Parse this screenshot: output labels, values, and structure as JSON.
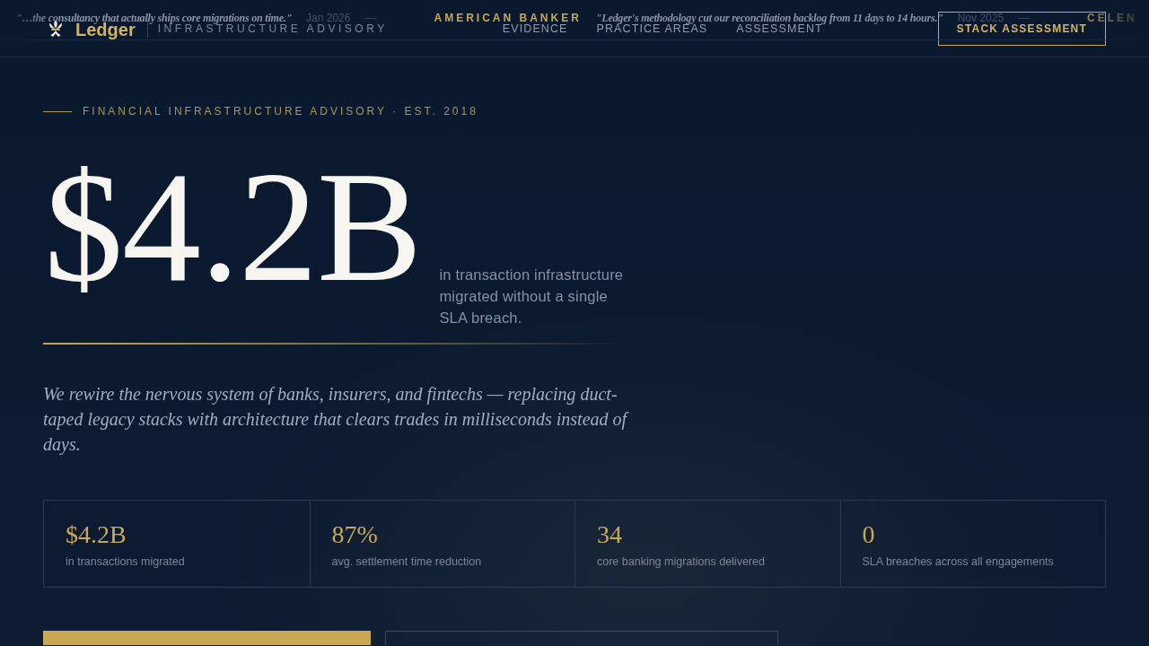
{
  "ticker": [
    {
      "quote": "\"…the consultancy that actually ships core migrations on time.\"",
      "date": "Jan 2026"
    },
    {
      "source": "AMERICAN BANKER",
      "quote": "\"Ledger's methodology cut our reconciliation backlog from 11 days to 14 hours.\"",
      "date": "Nov 2025"
    },
    {
      "source": "CELEN"
    }
  ],
  "nav": {
    "brand": "Ledger",
    "tagline": "INFRASTRUCTURE ADVISORY",
    "links": [
      "EVIDENCE",
      "PRACTICE AREAS",
      "ASSESSMENT"
    ],
    "cta": "STACK ASSESSMENT"
  },
  "hero": {
    "eyebrow": "FINANCIAL INFRASTRUCTURE ADVISORY · EST. 2018",
    "figure": "$4.2B",
    "figure_caption": "in transaction infrastructure migrated without a single SLA breach.",
    "lede": "We rewire the nervous system of banks, insurers, and fintechs — replacing duct-taped legacy stacks with architecture that clears trades in milliseconds instead of days."
  },
  "stats": [
    {
      "value": "$4.2B",
      "label": "in transactions migrated"
    },
    {
      "value": "87%",
      "label": "avg. settlement time reduction"
    },
    {
      "value": "34",
      "label": "core banking migrations delivered"
    },
    {
      "value": "0",
      "label": "SLA breaches across all engagements"
    }
  ],
  "actions": [
    {
      "kind": "primary"
    },
    {
      "kind": "secondary"
    }
  ]
}
